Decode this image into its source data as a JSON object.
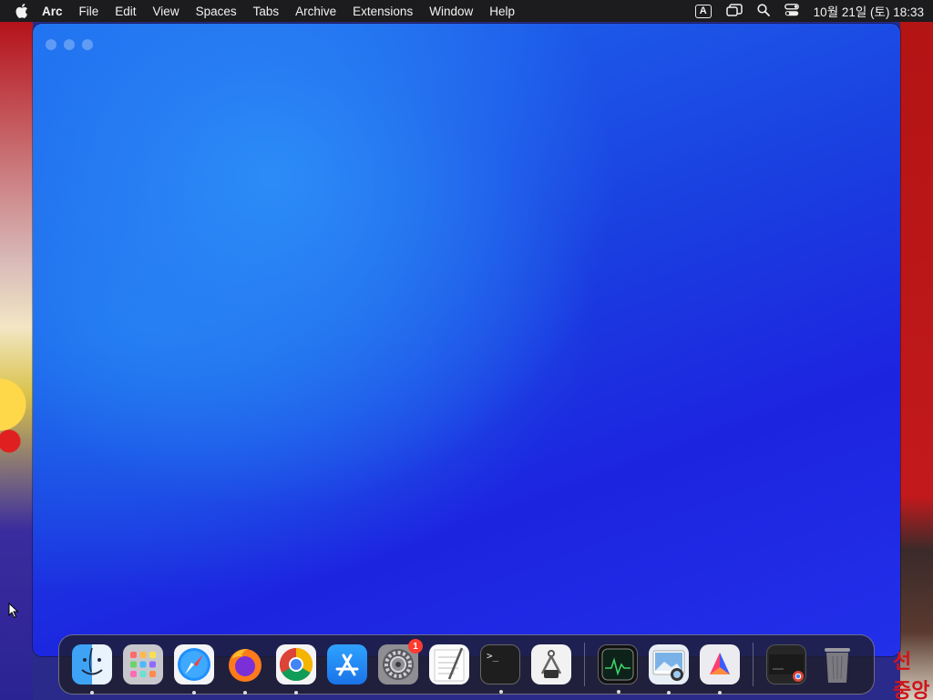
{
  "menubar": {
    "app_name": "Arc",
    "menus": [
      "File",
      "Edit",
      "View",
      "Spaces",
      "Tabs",
      "Archive",
      "Extensions",
      "Window",
      "Help"
    ],
    "input_source": "A",
    "clock": "10월 21일 (토) 18:33"
  },
  "window": {
    "app": "Arc",
    "accent_colors": [
      "#2c8cf7",
      "#1d24e0"
    ]
  },
  "dock": {
    "items": [
      {
        "name": "Finder",
        "icon": "finder-icon",
        "running": true
      },
      {
        "name": "Launchpad",
        "icon": "launchpad-icon",
        "running": false
      },
      {
        "name": "Safari",
        "icon": "safari-icon",
        "running": true
      },
      {
        "name": "Firefox",
        "icon": "firefox-icon",
        "running": true
      },
      {
        "name": "Chrome",
        "icon": "chrome-icon",
        "running": true
      },
      {
        "name": "App Store",
        "icon": "app-store-icon",
        "running": false
      },
      {
        "name": "System Settings",
        "icon": "settings-icon",
        "running": false,
        "badge": "1"
      },
      {
        "name": "TextEdit",
        "icon": "textedit-icon",
        "running": false
      },
      {
        "name": "Terminal",
        "icon": "terminal-icon",
        "running": true,
        "prompt": ">_"
      },
      {
        "name": "Instruments",
        "icon": "instruments-icon",
        "running": false
      },
      {
        "name": "Activity Monitor",
        "icon": "activity-monitor-icon",
        "running": true
      },
      {
        "name": "Preview",
        "icon": "preview-icon",
        "running": true
      },
      {
        "name": "Affinity",
        "icon": "affinity-icon",
        "running": true
      },
      {
        "name": "Minimized Window",
        "icon": "minimized-window-icon",
        "running": false
      },
      {
        "name": "Trash",
        "icon": "trash-icon",
        "running": false
      }
    ]
  },
  "wallpaper_text": "선 중앙"
}
